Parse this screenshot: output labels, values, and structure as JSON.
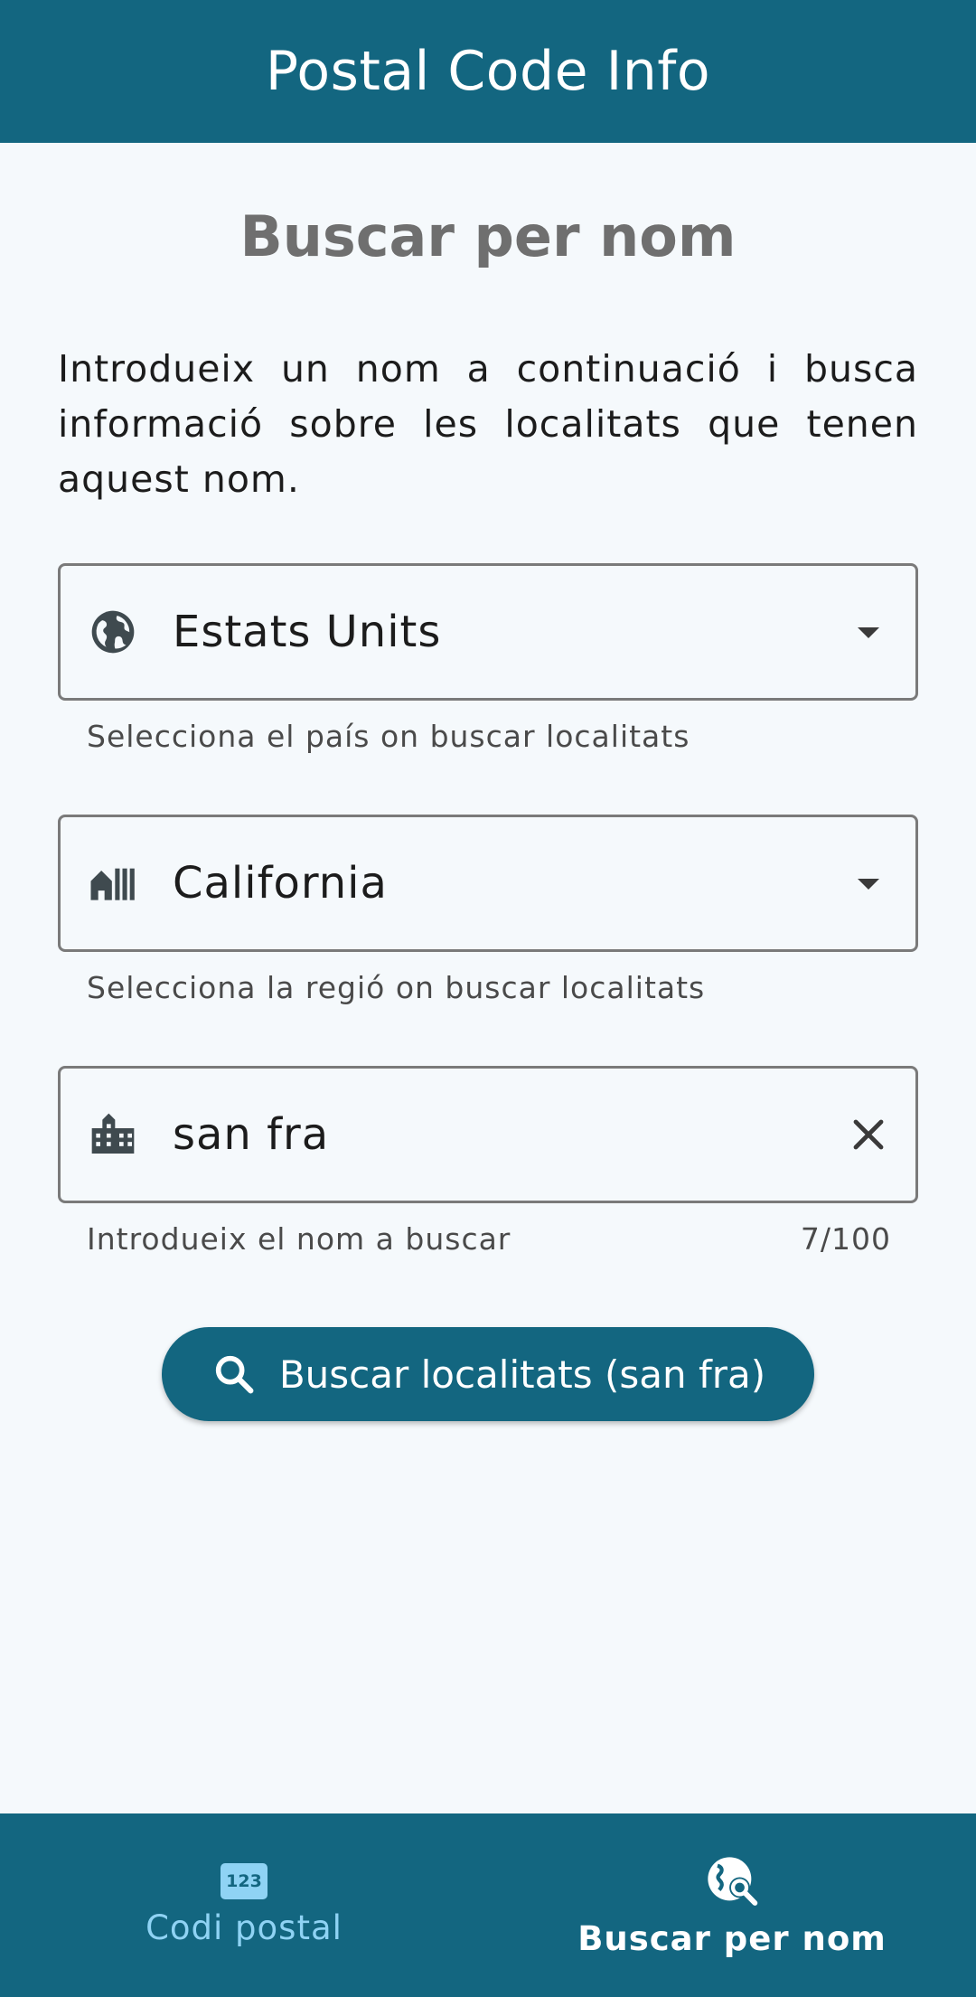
{
  "app_bar": {
    "title": "Postal Code Info"
  },
  "page": {
    "title": "Buscar per nom",
    "intro": "Introdueix un nom a continuació i busca informació sobre les localitats que tenen aquest nom."
  },
  "country_field": {
    "value": "Estats Units",
    "helper": "Selecciona el país on buscar localitats",
    "icon": "globe-icon"
  },
  "region_field": {
    "value": "California",
    "helper": "Selecciona la regió on buscar localitats",
    "icon": "holiday-village-icon"
  },
  "name_field": {
    "value": "san fra",
    "helper": "Introdueix el nom a buscar",
    "counter": "7/100",
    "icon": "city-icon"
  },
  "search_button": {
    "label": "Buscar localitats (san fra)"
  },
  "bottom_nav": {
    "items": [
      {
        "label": "Codi postal",
        "icon": "numbers-123-icon",
        "badge": "123",
        "selected": false
      },
      {
        "label": "Buscar per nom",
        "icon": "travel-explore-icon",
        "selected": true
      }
    ]
  },
  "colors": {
    "primary": "#136680",
    "background": "#f5f9fc",
    "nav_inactive": "#8fd3f4"
  }
}
